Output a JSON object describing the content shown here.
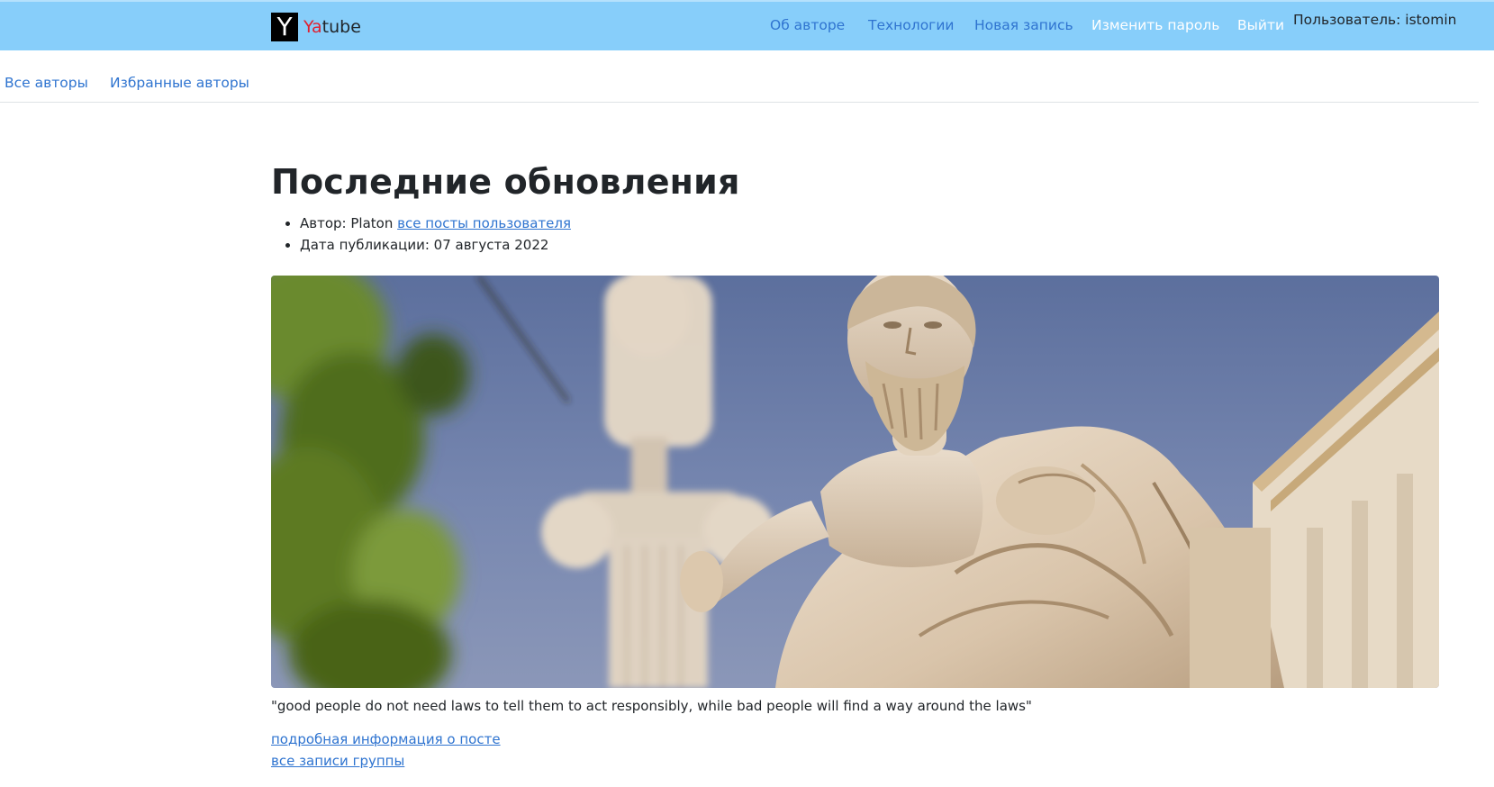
{
  "header": {
    "brand_ya": "Ya",
    "brand_tube": "tube",
    "brand_logo_letter": "Y",
    "nav": {
      "about": "Об авторе",
      "tech": "Технологии",
      "new_post": "Новая запись",
      "change_password": "Изменить пароль",
      "logout": "Выйти"
    },
    "user_label": "Пользователь: istomin"
  },
  "subnav": {
    "all_authors": "Все авторы",
    "favorite_authors": "Избранные авторы"
  },
  "main": {
    "title": "Последние обновления",
    "author_prefix": "Автор: Platon",
    "author_posts_link": "все посты пользователя",
    "date_label": "Дата публикации: 07 августа 2022",
    "image_subject": "statue-of-plato",
    "post_text": "\"good people do not need laws to tell them to act responsibly, while bad people will find a way around the laws\"",
    "details_link": "подробная информация о посте",
    "group_link": "все записи группы"
  },
  "colors": {
    "navbar_bg": "#87cefa",
    "link_blue": "#2f74d0",
    "brand_red": "#e0202f"
  }
}
